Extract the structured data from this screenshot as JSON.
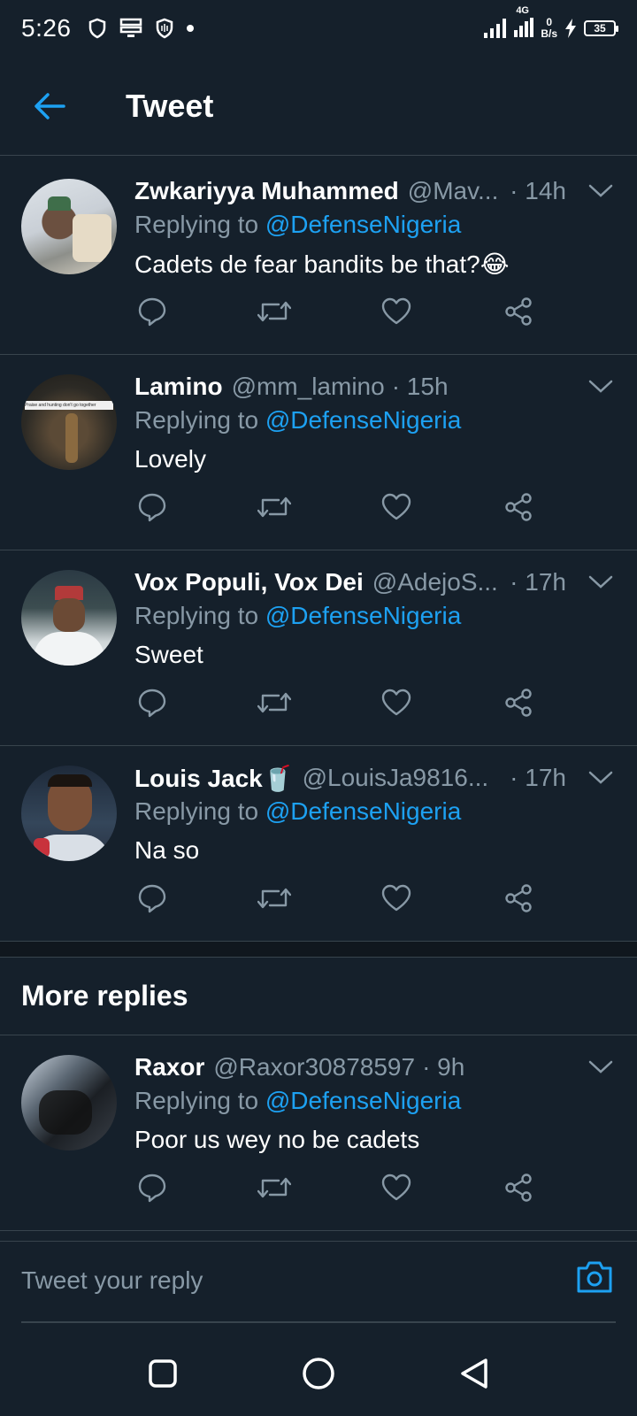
{
  "status_bar": {
    "time": "5:26",
    "network": "4G",
    "net_speed_value": "0",
    "net_speed_unit": "B/s",
    "battery": "35"
  },
  "header": {
    "title": "Tweet"
  },
  "tweets": [
    {
      "name": "Zwkariyya Muhammed",
      "handle": "@Mav...",
      "time": "· 14h",
      "replying_prefix": "Replying to ",
      "mention": "@DefenseNigeria",
      "text": "Cadets de fear bandits be that?😂"
    },
    {
      "name": "Lamino",
      "handle": "@mm_lamino",
      "time": "· 15h",
      "replying_prefix": "Replying to ",
      "mention": "@DefenseNigeria",
      "text": "Lovely",
      "avatar_text": "Praise and hunting don't go together"
    },
    {
      "name": "Vox Populi, Vox Dei",
      "handle": "@AdejoS...",
      "time": "· 17h",
      "replying_prefix": "Replying to ",
      "mention": "@DefenseNigeria",
      "text": "Sweet"
    },
    {
      "name": "Louis Jack🥤",
      "handle": "@LouisJa9816...",
      "time": "· 17h",
      "replying_prefix": "Replying to ",
      "mention": "@DefenseNigeria",
      "text": "Na so"
    }
  ],
  "more_replies": {
    "title": "More replies",
    "tweets": [
      {
        "name": "Raxor",
        "handle": "@Raxor30878597",
        "time": "· 9h",
        "replying_prefix": "Replying to ",
        "mention": "@DefenseNigeria",
        "text": "Poor us wey no be cadets"
      }
    ]
  },
  "reply_bar": {
    "placeholder": "Tweet your reply"
  },
  "icons": {
    "back": "arrow-left-icon",
    "caret": "chevron-down-icon",
    "reply": "comment-icon",
    "retweet": "retweet-icon",
    "like": "heart-icon",
    "share": "share-icon",
    "camera": "camera-icon"
  },
  "colors": {
    "background": "#15202b",
    "accent": "#1da1f2",
    "secondary_text": "#8899a6",
    "divider": "#38444d"
  }
}
